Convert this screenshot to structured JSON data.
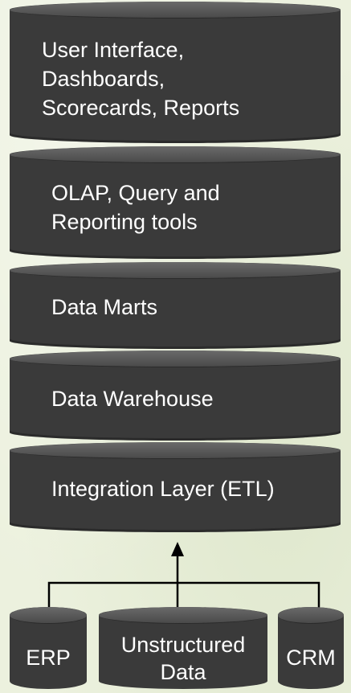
{
  "layers": [
    {
      "label": "User Interface,\nDashboards,\nScorecards, Reports"
    },
    {
      "label": "OLAP, Query and\nReporting tools"
    },
    {
      "label": "Data Marts"
    },
    {
      "label": "Data Warehouse"
    },
    {
      "label": "Integration Layer (ETL)"
    }
  ],
  "sources": [
    {
      "label": "ERP"
    },
    {
      "label": "Unstructured\nData"
    },
    {
      "label": "CRM"
    }
  ],
  "colors": {
    "background": "#ecf1de",
    "layer_fill": "#3a3a3a",
    "text": "#ffffff",
    "connector": "#000000"
  }
}
